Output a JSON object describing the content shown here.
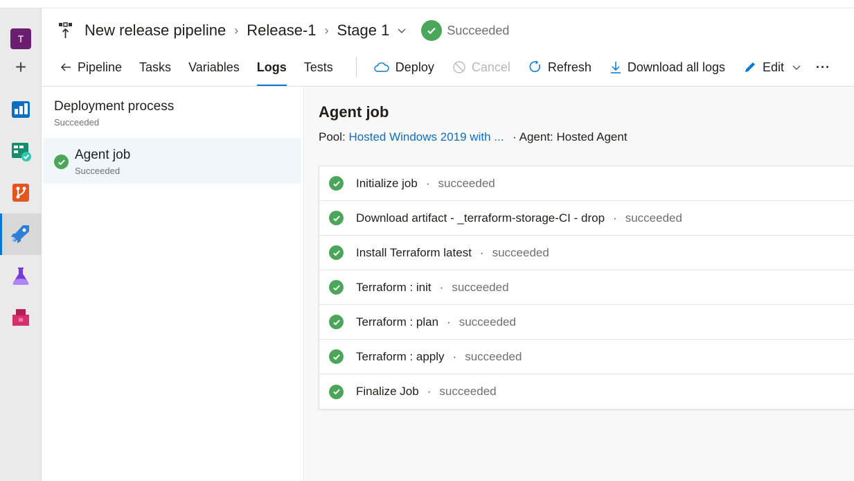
{
  "header": {
    "pipeline_name": "New release pipeline",
    "release_name": "Release-1",
    "stage_name": "Stage 1",
    "status": "Succeeded"
  },
  "rail": {
    "avatar_letter": "T"
  },
  "toolbar": {
    "back_label": "Pipeline",
    "tabs": [
      "Tasks",
      "Variables",
      "Logs",
      "Tests"
    ],
    "active_tab": "Logs",
    "deploy": "Deploy",
    "cancel": "Cancel",
    "refresh": "Refresh",
    "download": "Download all logs",
    "edit": "Edit",
    "more": "···"
  },
  "left_panel": {
    "process_title": "Deployment process",
    "process_status": "Succeeded",
    "job_title": "Agent job",
    "job_status": "Succeeded"
  },
  "main": {
    "job_title": "Agent job",
    "pool_label": "Pool:",
    "pool_value": "Hosted Windows 2019 with ...",
    "agent_text": "· Agent: Hosted Agent",
    "steps": [
      {
        "name": "Initialize job",
        "status": "succeeded"
      },
      {
        "name": "Download artifact - _terraform-storage-CI - drop",
        "status": "succeeded"
      },
      {
        "name": "Install Terraform latest",
        "status": "succeeded"
      },
      {
        "name": "Terraform : init",
        "status": "succeeded"
      },
      {
        "name": "Terraform : plan",
        "status": "succeeded"
      },
      {
        "name": "Terraform : apply",
        "status": "succeeded"
      },
      {
        "name": "Finalize Job",
        "status": "succeeded"
      }
    ]
  },
  "colors": {
    "accent": "#0078d4",
    "success": "#4ba65a",
    "link": "#106ebe"
  }
}
